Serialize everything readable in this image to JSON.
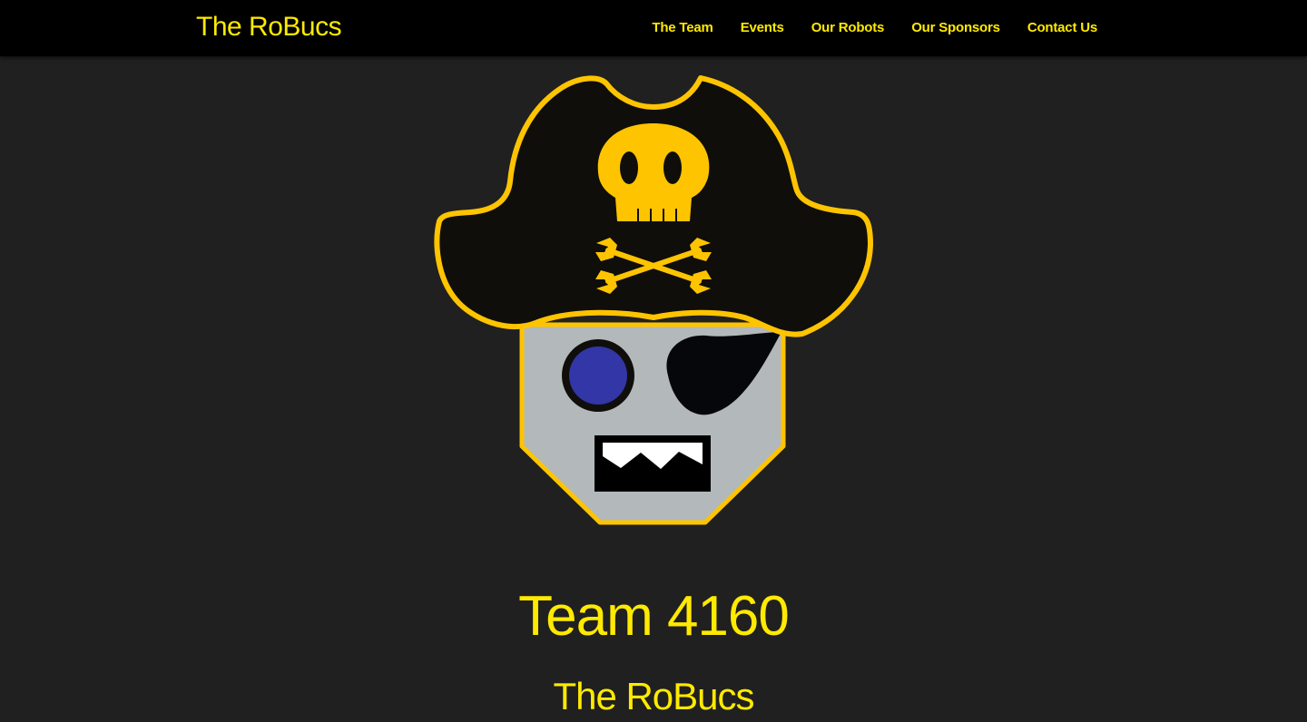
{
  "navbar": {
    "brand": "The RoBucs",
    "links": [
      {
        "label": "The Team"
      },
      {
        "label": "Events"
      },
      {
        "label": "Our Robots"
      },
      {
        "label": "Our Sponsors"
      },
      {
        "label": "Contact Us"
      }
    ]
  },
  "hero": {
    "title": "Team 4160",
    "subtitle": "The RoBucs",
    "logo_icon": "pirate-robot-logo-icon"
  },
  "colors": {
    "accent": "#ffea00",
    "logo_gold": "#ffc400",
    "navbar_bg": "#000000",
    "page_bg": "#202020",
    "robot_face": "#b3b8bb",
    "robot_eye": "#3236a6",
    "hat": "#100e0b"
  }
}
